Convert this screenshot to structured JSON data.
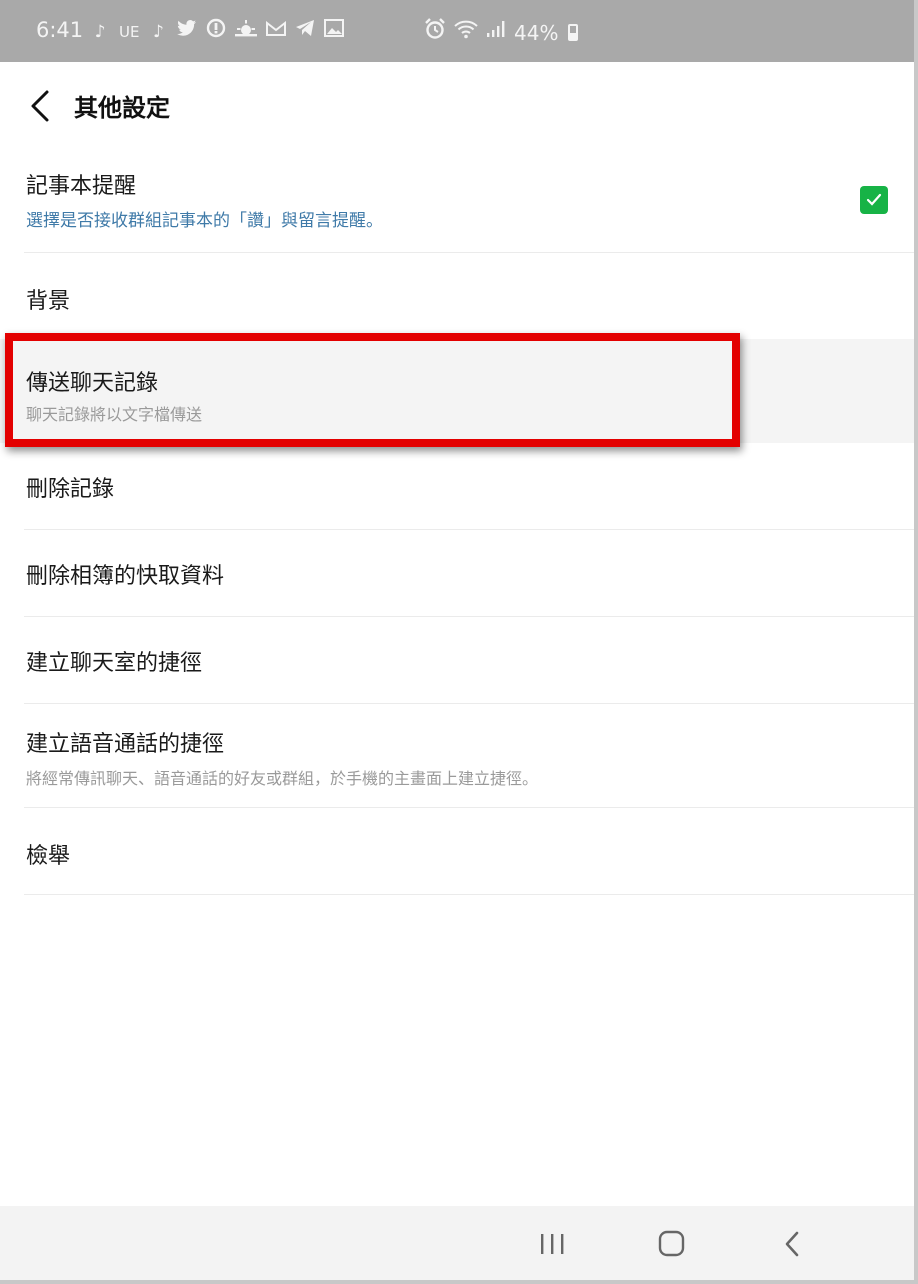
{
  "status_bar": {
    "time": "6:41",
    "left_icons": [
      "tiktok-icon",
      "ue-icon",
      "tiktok-icon",
      "twitter-icon",
      "notification-icon",
      "weather-icon",
      "mail-icon",
      "telegram-icon",
      "image-icon"
    ],
    "ue_label": "UE",
    "right_icons": [
      "alarm-icon",
      "wifi-icon",
      "signal-icon"
    ],
    "battery": "44%"
  },
  "header": {
    "title": "其他設定"
  },
  "settings": {
    "items": [
      {
        "title": "記事本提醒",
        "subtitle": "選擇是否接收群組記事本的「讚」與留言提醒。",
        "checked": true
      },
      {
        "title": "背景"
      },
      {
        "title": "傳送聊天記錄",
        "subtitle": "聊天記錄將以文字檔傳送",
        "highlighted": true
      },
      {
        "title": "刪除記錄"
      },
      {
        "title": "刪除相簿的快取資料"
      },
      {
        "title": "建立聊天室的捷徑"
      },
      {
        "title": "建立語音通話的捷徑",
        "subtitle": "將經常傳訊聊天、語音通話的好友或群組，於手機的主畫面上建立捷徑。"
      },
      {
        "title": "檢舉"
      }
    ]
  },
  "colors": {
    "status_bar": "#a9a9a9",
    "subtitle_blue": "#3f7aa8",
    "checkbox_green": "#17b346",
    "highlight_red": "#e30000",
    "highlighted_row": "#f4f4f4"
  },
  "nav_bar": {
    "icons": [
      "recent-apps-icon",
      "home-icon",
      "back-icon"
    ]
  }
}
